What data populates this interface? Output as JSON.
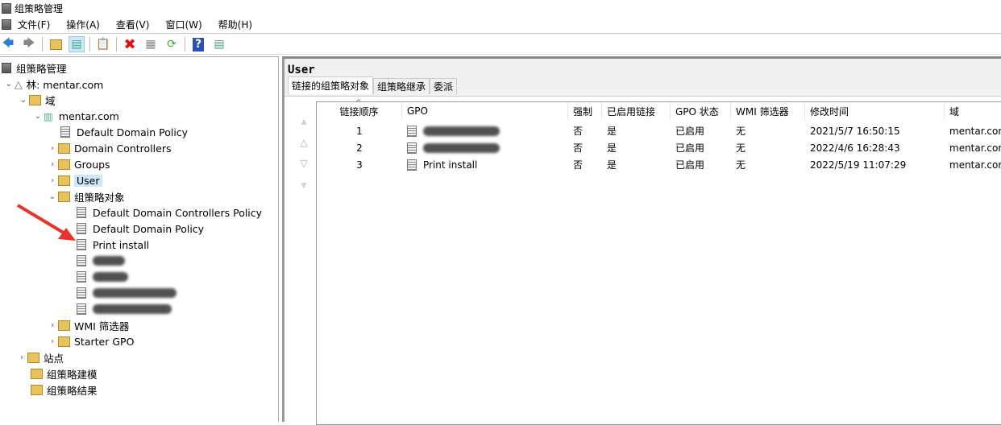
{
  "window": {
    "title": "组策略管理"
  },
  "menu": [
    "文件(F)",
    "操作(A)",
    "查看(V)",
    "窗口(W)",
    "帮助(H)"
  ],
  "toolbar": [
    "back-icon",
    "forward-icon",
    "up-folder-icon",
    "show-hide-tree-icon",
    "clipboard-icon",
    "delete-icon",
    "properties-icon",
    "refresh-icon",
    "help-icon",
    "action-pane-icon"
  ],
  "tree": {
    "root": "组策略管理",
    "forest": "林: mentar.com",
    "domains": "域",
    "domain": "mentar.com",
    "domain_children": [
      "Default Domain Policy",
      "Domain Controllers",
      "Groups",
      "User"
    ],
    "gpo_container": "组策略对象",
    "gpos": [
      "Default Domain Controllers Policy",
      "Default Domain Policy",
      "Print install"
    ],
    "wmi": "WMI 筛选器",
    "starter": "Starter GPO",
    "sites": "站点",
    "modeling": "组策略建模",
    "results": "组策略结果"
  },
  "detail": {
    "title": "User",
    "tabs": [
      "链接的组策略对象",
      "组策略继承",
      "委派"
    ],
    "columns": [
      "链接顺序",
      "GPO",
      "强制",
      "已启用链接",
      "GPO 状态",
      "WMI 筛选器",
      "修改时间",
      "域"
    ],
    "rows": [
      {
        "order": "1",
        "gpo": "",
        "enforced": "否",
        "enabled": "是",
        "status": "已启用",
        "wmi": "无",
        "modified": "2021/5/7 16:50:15",
        "domain": "mentar.com"
      },
      {
        "order": "2",
        "gpo": "",
        "enforced": "否",
        "enabled": "是",
        "status": "已启用",
        "wmi": "无",
        "modified": "2022/4/6 16:28:43",
        "domain": "mentar.com"
      },
      {
        "order": "3",
        "gpo": "Print install",
        "enforced": "否",
        "enabled": "是",
        "status": "已启用",
        "wmi": "无",
        "modified": "2022/5/19 11:07:29",
        "domain": "mentar.com"
      }
    ]
  }
}
